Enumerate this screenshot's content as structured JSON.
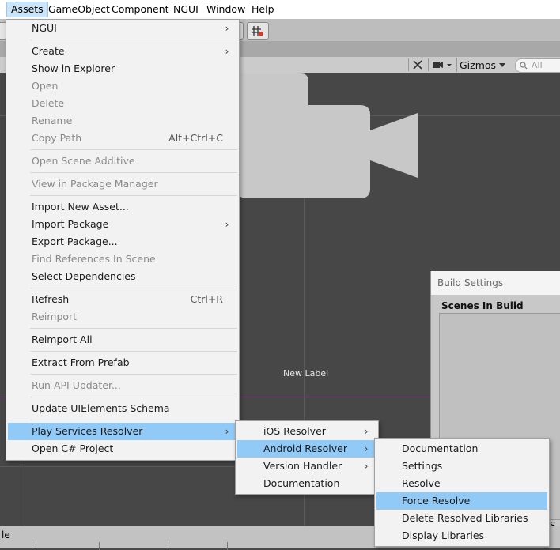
{
  "menubar": {
    "items": [
      "Assets",
      "GameObject",
      "Component",
      "NGUI",
      "Window",
      "Help"
    ]
  },
  "scene_toolbar": {
    "gizmos_label": "Gizmos",
    "search_placeholder": "All"
  },
  "scene": {
    "new_label": "New Label"
  },
  "bottom": {
    "left_fragment": "le"
  },
  "build_settings": {
    "title": "Build Settings",
    "scenes_header": "Scenes In Build",
    "right_fragment": "S"
  },
  "assets_menu": {
    "ngui": "NGUI",
    "create": "Create",
    "show_in_explorer": "Show in Explorer",
    "open": "Open",
    "delete": "Delete",
    "rename": "Rename",
    "copy_path": "Copy Path",
    "copy_path_shortcut": "Alt+Ctrl+C",
    "open_scene_additive": "Open Scene Additive",
    "view_in_package_manager": "View in Package Manager",
    "import_new_asset": "Import New Asset...",
    "import_package": "Import Package",
    "export_package": "Export Package...",
    "find_references": "Find References In Scene",
    "select_dependencies": "Select Dependencies",
    "refresh": "Refresh",
    "refresh_shortcut": "Ctrl+R",
    "reimport": "Reimport",
    "reimport_all": "Reimport All",
    "extract_from_prefab": "Extract From Prefab",
    "run_api_updater": "Run API Updater...",
    "update_uielements": "Update UIElements Schema",
    "play_services_resolver": "Play Services Resolver",
    "open_csharp_project": "Open C# Project"
  },
  "resolver_menu": {
    "ios_resolver": "iOS Resolver",
    "android_resolver": "Android Resolver",
    "version_handler": "Version Handler",
    "documentation": "Documentation"
  },
  "android_menu": {
    "documentation": "Documentation",
    "settings": "Settings",
    "resolve": "Resolve",
    "force_resolve": "Force Resolve",
    "delete_resolved_libraries": "Delete Resolved Libraries",
    "display_libraries": "Display Libraries"
  },
  "colors": {
    "highlight": "#91c9f7",
    "menu_bg": "#f2f2f2",
    "scene_bg": "#474747"
  }
}
